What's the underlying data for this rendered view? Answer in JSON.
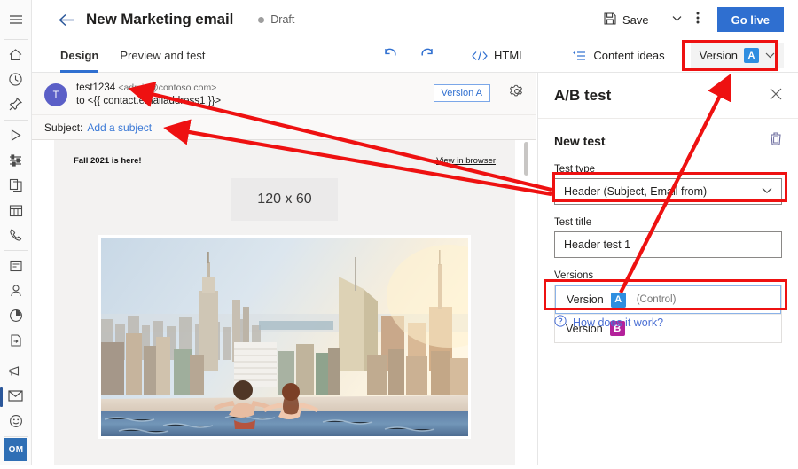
{
  "rail": {
    "items": [
      {
        "name": "hamburger-menu",
        "icon": "hamburger"
      },
      {
        "name": "home",
        "icon": "home"
      },
      {
        "name": "recent",
        "icon": "clock"
      },
      {
        "name": "pinned",
        "icon": "pin"
      },
      {
        "name": "play",
        "icon": "play"
      },
      {
        "name": "segments",
        "icon": "sliders"
      },
      {
        "name": "content",
        "icon": "pages"
      },
      {
        "name": "calendar",
        "icon": "calendar"
      },
      {
        "name": "phone",
        "icon": "phone"
      },
      {
        "name": "forms",
        "icon": "form"
      },
      {
        "name": "contacts",
        "icon": "person"
      },
      {
        "name": "analytics",
        "icon": "pie"
      },
      {
        "name": "templates",
        "icon": "doc-arrow"
      },
      {
        "name": "campaigns",
        "icon": "megaphone"
      },
      {
        "name": "emails",
        "icon": "envelope"
      },
      {
        "name": "social",
        "icon": "smiley"
      },
      {
        "name": "events",
        "icon": "calendar2"
      }
    ],
    "avatar_initials": "OM"
  },
  "topbar": {
    "back_icon": "arrow-left",
    "title": "New Marketing email",
    "status": "Draft",
    "save_label": "Save",
    "save_icon": "floppy-disk",
    "save_caret_icon": "chevron-down",
    "more_icon": "ellipsis-vertical",
    "go_live_label": "Go live"
  },
  "tabs": {
    "items": [
      {
        "label": "Design",
        "selected": true
      },
      {
        "label": "Preview and test",
        "selected": false
      }
    ],
    "undo_icon": "undo-arrow",
    "redo_icon": "redo-arrow",
    "html_label": "HTML",
    "html_icon": "code-brackets",
    "content_ideas_label": "Content ideas",
    "content_ideas_icon": "list-sparkle",
    "version_chip": {
      "label": "Version",
      "badge": "A",
      "chevron": "chevron-down"
    }
  },
  "email": {
    "avatar_initial": "T",
    "from_name": "test1234",
    "from_address": "<admin@contoso.com>",
    "to_line": "to <{{ contact.emailaddress1 }}>",
    "version_pill": "Version A",
    "gear_icon": "gear-icon",
    "subject_label": "Subject:",
    "subject_placeholder": "Add a subject",
    "body": {
      "preheader": "Fall 2021 is here!",
      "view_in_browser": "View in browser",
      "logo_placeholder": "120 x 60"
    }
  },
  "panel": {
    "title": "A/B test",
    "close_icon": "close-icon",
    "new_test_label": "New test",
    "delete_icon": "trash-icon",
    "test_type": {
      "label": "Test type",
      "value": "Header (Subject, Email from)",
      "chevron": "chevron-down"
    },
    "test_title": {
      "label": "Test title",
      "value": "Header test 1"
    },
    "versions": {
      "label": "Versions",
      "items": [
        {
          "label": "Version",
          "badge": "A",
          "note": "(Control)",
          "selected": true
        },
        {
          "label": "Version",
          "badge": "B",
          "note": "",
          "selected": false
        }
      ]
    },
    "help_link": "How does it work?",
    "help_icon": "question-circle-icon"
  },
  "colors": {
    "accent_blue": "#2f6fd0",
    "badge_a": "#2f8ee0",
    "badge_b": "#b4219b",
    "annotation_red": "#ee1111",
    "avatar_purple": "#5b5fc7",
    "om_blue": "#2f6fb5"
  }
}
